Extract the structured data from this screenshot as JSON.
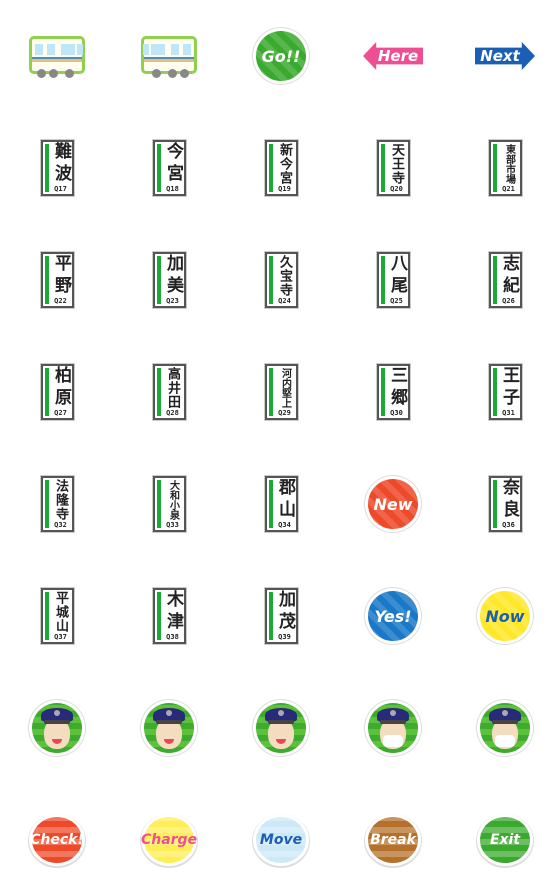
{
  "cells": [
    {
      "type": "train",
      "part": "front",
      "label": ""
    },
    {
      "type": "train",
      "part": "rear",
      "label": ""
    },
    {
      "type": "burst",
      "label": "Go!!",
      "color": "#3aaa2e"
    },
    {
      "type": "arrow-left",
      "label": "Here",
      "color": "#ee4f92"
    },
    {
      "type": "arrow-right",
      "label": "Next",
      "color": "#1a5fb4"
    },
    {
      "type": "sign",
      "label": "難波",
      "code": "Q17"
    },
    {
      "type": "sign",
      "label": "今宮",
      "code": "Q18"
    },
    {
      "type": "sign",
      "label": "新今宮",
      "code": "Q19"
    },
    {
      "type": "sign",
      "label": "天王寺",
      "code": "Q20"
    },
    {
      "type": "sign",
      "label": "東部市場",
      "code": "Q21"
    },
    {
      "type": "sign",
      "label": "平野",
      "code": "Q22"
    },
    {
      "type": "sign",
      "label": "加美",
      "code": "Q23"
    },
    {
      "type": "sign",
      "label": "久宝寺",
      "code": "Q24"
    },
    {
      "type": "sign",
      "label": "八尾",
      "code": "Q25"
    },
    {
      "type": "sign",
      "label": "志紀",
      "code": "Q26"
    },
    {
      "type": "sign",
      "label": "柏原",
      "code": "Q27"
    },
    {
      "type": "sign",
      "label": "高井田",
      "code": "Q28"
    },
    {
      "type": "sign",
      "label": "河内堅上",
      "code": "Q29"
    },
    {
      "type": "sign",
      "label": "三郷",
      "code": "Q30"
    },
    {
      "type": "sign",
      "label": "王子",
      "code": "Q31"
    },
    {
      "type": "sign",
      "label": "法隆寺",
      "code": "Q32"
    },
    {
      "type": "sign",
      "label": "大和小泉",
      "code": "Q33"
    },
    {
      "type": "sign",
      "label": "郡山",
      "code": "Q34"
    },
    {
      "type": "burst",
      "label": "New",
      "color": "#ee4a2a"
    },
    {
      "type": "sign",
      "label": "奈良",
      "code": "Q36"
    },
    {
      "type": "sign",
      "label": "平城山",
      "code": "Q37"
    },
    {
      "type": "sign",
      "label": "木津",
      "code": "Q38"
    },
    {
      "type": "sign",
      "label": "加茂",
      "code": "Q39"
    },
    {
      "type": "burst",
      "label": "Yes!",
      "color": "#1a78c8"
    },
    {
      "type": "burst",
      "label": "Now",
      "color": "#ffe82a",
      "text_color": "#1a5fb4"
    },
    {
      "type": "face",
      "variant": "smile",
      "label": ""
    },
    {
      "type": "face",
      "variant": "camera",
      "label": ""
    },
    {
      "type": "face",
      "variant": "wink",
      "label": ""
    },
    {
      "type": "face",
      "variant": "mask",
      "label": ""
    },
    {
      "type": "face",
      "variant": "mask-smile",
      "label": ""
    },
    {
      "type": "bubble",
      "label": "Check!",
      "color": "#ee4a2a",
      "text_color": "#ffffff"
    },
    {
      "type": "bubble",
      "label": "Charge",
      "color": "#ffee55",
      "text_color": "#ee4f92"
    },
    {
      "type": "bubble",
      "label": "Move",
      "color": "#cde9f8",
      "text_color": "#1a5fb4"
    },
    {
      "type": "bubble",
      "label": "Break",
      "color": "#b5702a",
      "text_color": "#ffffff"
    },
    {
      "type": "bubble",
      "label": "Exit",
      "color": "#3aaa2e",
      "text_color": "#ffffff"
    }
  ]
}
